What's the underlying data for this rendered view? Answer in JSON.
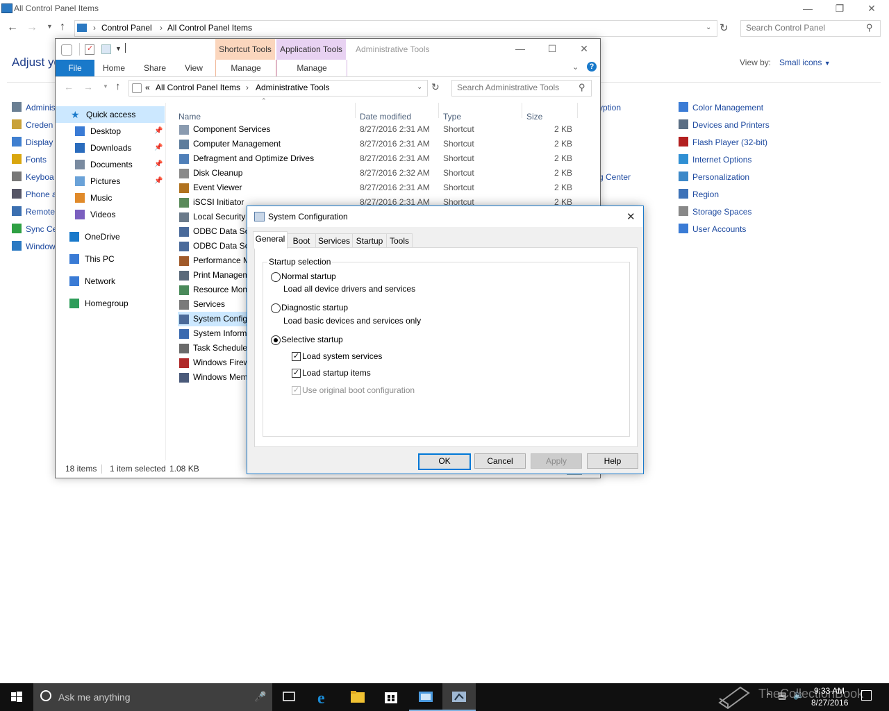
{
  "control_panel": {
    "title": "All Control Panel Items",
    "address": {
      "root": "Control Panel",
      "current": "All Control Panel Items"
    },
    "search_placeholder": "Search Control Panel",
    "heading": "Adjust yo",
    "view_by_label": "View by:",
    "view_by_value": "Small icons",
    "left_col": [
      "Adminis",
      "Creden",
      "Display",
      "Fonts",
      "Keyboa",
      "Phone a",
      "Remote",
      "Sync Ce",
      "Window"
    ],
    "mid_col": [
      "yption",
      "g Center"
    ],
    "right_col": [
      "Color Management",
      "Devices and Printers",
      "Flash Player (32-bit)",
      "Internet Options",
      "Personalization",
      "Region",
      "Storage Spaces",
      "User Accounts"
    ]
  },
  "explorer": {
    "title": "Administrative Tools",
    "ctx_shortcut": "Shortcut Tools",
    "ctx_application": "Application Tools",
    "tabs": [
      "File",
      "Home",
      "Share",
      "View"
    ],
    "manage": "Manage",
    "address": {
      "prefix": "«",
      "parent": "All Control Panel Items",
      "current": "Administrative Tools"
    },
    "search_placeholder": "Search Administrative Tools",
    "nav": [
      {
        "label": "Quick access",
        "pinned": false
      },
      {
        "label": "Desktop",
        "pinned": true
      },
      {
        "label": "Downloads",
        "pinned": true
      },
      {
        "label": "Documents",
        "pinned": true
      },
      {
        "label": "Pictures",
        "pinned": true
      },
      {
        "label": "Music",
        "pinned": false
      },
      {
        "label": "Videos",
        "pinned": false
      },
      {
        "label": "OneDrive",
        "pinned": false
      },
      {
        "label": "This PC",
        "pinned": false
      },
      {
        "label": "Network",
        "pinned": false
      },
      {
        "label": "Homegroup",
        "pinned": false
      }
    ],
    "columns": {
      "name": "Name",
      "date": "Date modified",
      "type": "Type",
      "size": "Size"
    },
    "files": [
      {
        "name": "Component Services",
        "date": "8/27/2016 2:31 AM",
        "type": "Shortcut",
        "size": "2 KB"
      },
      {
        "name": "Computer Management",
        "date": "8/27/2016 2:31 AM",
        "type": "Shortcut",
        "size": "2 KB"
      },
      {
        "name": "Defragment and Optimize Drives",
        "date": "8/27/2016 2:31 AM",
        "type": "Shortcut",
        "size": "2 KB"
      },
      {
        "name": "Disk Cleanup",
        "date": "8/27/2016 2:32 AM",
        "type": "Shortcut",
        "size": "2 KB"
      },
      {
        "name": "Event Viewer",
        "date": "8/27/2016 2:31 AM",
        "type": "Shortcut",
        "size": "2 KB"
      },
      {
        "name": "iSCSI Initiator",
        "date": "8/27/2016 2:31 AM",
        "type": "Shortcut",
        "size": "2 KB"
      },
      {
        "name": "Local Security I",
        "date": "",
        "type": "",
        "size": ""
      },
      {
        "name": "ODBC Data Sou",
        "date": "",
        "type": "",
        "size": ""
      },
      {
        "name": "ODBC Data Sou",
        "date": "",
        "type": "",
        "size": ""
      },
      {
        "name": "Performance M",
        "date": "",
        "type": "",
        "size": ""
      },
      {
        "name": "Print Managem",
        "date": "",
        "type": "",
        "size": ""
      },
      {
        "name": "Resource Moni",
        "date": "",
        "type": "",
        "size": ""
      },
      {
        "name": "Services",
        "date": "",
        "type": "",
        "size": ""
      },
      {
        "name": "System Config",
        "date": "",
        "type": "",
        "size": ""
      },
      {
        "name": "System Inform",
        "date": "",
        "type": "",
        "size": ""
      },
      {
        "name": "Task Scheduler",
        "date": "",
        "type": "",
        "size": ""
      },
      {
        "name": "Windows Firew",
        "date": "",
        "type": "",
        "size": ""
      },
      {
        "name": "Windows Mem",
        "date": "",
        "type": "",
        "size": ""
      }
    ],
    "selected_index": 13,
    "status": {
      "count": "18 items",
      "selection": "1 item selected",
      "size": "1.08 KB"
    }
  },
  "dialog": {
    "title": "System Configuration",
    "tabs": [
      "General",
      "Boot",
      "Services",
      "Startup",
      "Tools"
    ],
    "group_label": "Startup selection",
    "normal": {
      "label": "Normal startup",
      "desc": "Load all device drivers and services"
    },
    "diagnostic": {
      "label": "Diagnostic startup",
      "desc": "Load basic devices and services only"
    },
    "selective": {
      "label": "Selective startup"
    },
    "load_system_services": "Load system services",
    "load_startup_items": "Load startup items",
    "use_original_boot": "Use original boot configuration",
    "buttons": {
      "ok": "OK",
      "cancel": "Cancel",
      "apply": "Apply",
      "help": "Help"
    }
  },
  "taskbar": {
    "search_placeholder": "Ask me anything",
    "watermark": "TheCollectionBook",
    "time": "9:33 AM",
    "date": "8/27/2016"
  }
}
